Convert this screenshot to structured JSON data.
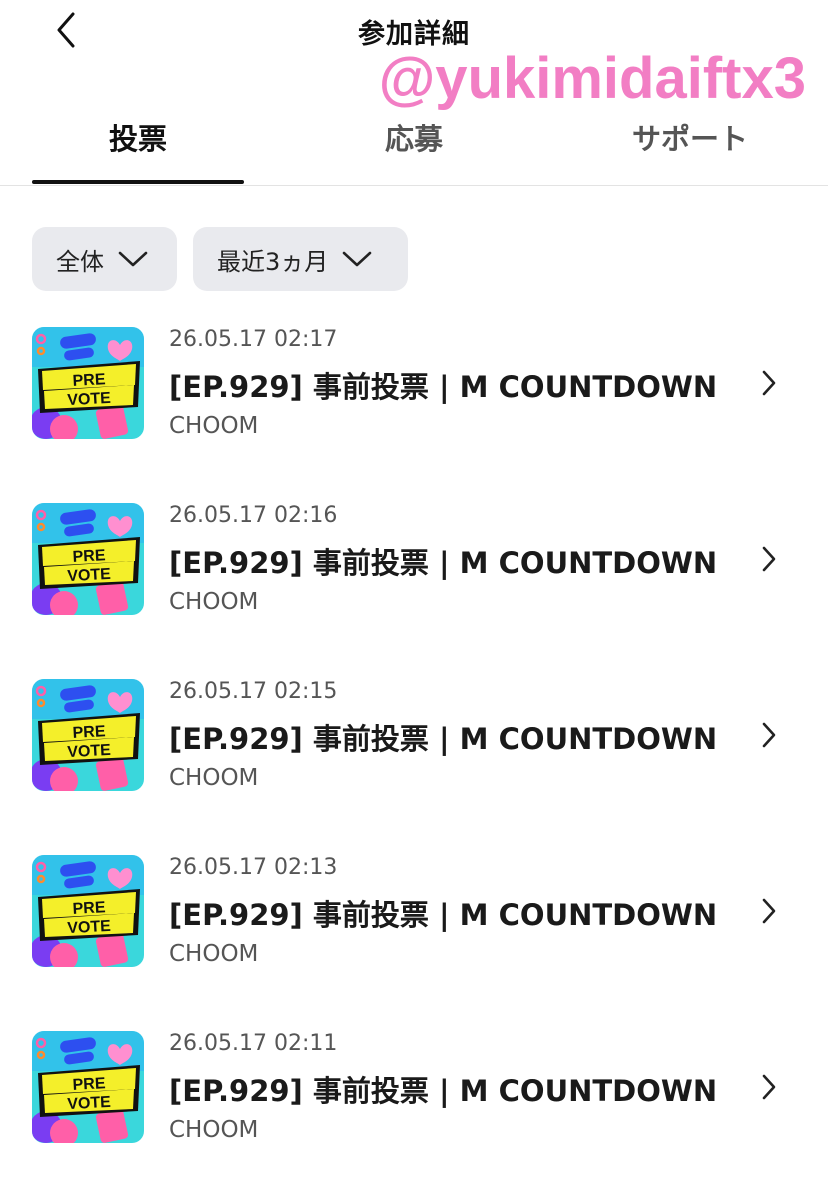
{
  "header": {
    "title": "参加詳細"
  },
  "watermark": "@yukimidaiftx3",
  "tabs": [
    {
      "label": "投票",
      "active": true
    },
    {
      "label": "応募",
      "active": false
    },
    {
      "label": "サポート",
      "active": false
    }
  ],
  "filters": [
    {
      "label": "全体",
      "icon": "chevron-down-icon"
    },
    {
      "label": "最近3ヵ月",
      "icon": "chevron-down-icon"
    }
  ],
  "thumbnail": {
    "line1": "PRE",
    "line2": "VOTE",
    "colors": {
      "background": "#3ad7dc",
      "banner": "#f4ef2a",
      "accent_pink": "#ff5fa8",
      "accent_blue": "#2d4ff0",
      "accent_purple": "#7a3df2"
    }
  },
  "items": [
    {
      "date": "26.05.17 02:17",
      "title": "[EP.929] 事前投票 | M COUNTDOWN",
      "subtitle": "CHOOM"
    },
    {
      "date": "26.05.17 02:16",
      "title": "[EP.929] 事前投票 | M COUNTDOWN",
      "subtitle": "CHOOM"
    },
    {
      "date": "26.05.17 02:15",
      "title": "[EP.929] 事前投票 | M COUNTDOWN",
      "subtitle": "CHOOM"
    },
    {
      "date": "26.05.17 02:13",
      "title": "[EP.929] 事前投票 | M COUNTDOWN",
      "subtitle": "CHOOM"
    },
    {
      "date": "26.05.17 02:11",
      "title": "[EP.929] 事前投票 | M COUNTDOWN",
      "subtitle": "CHOOM"
    }
  ]
}
